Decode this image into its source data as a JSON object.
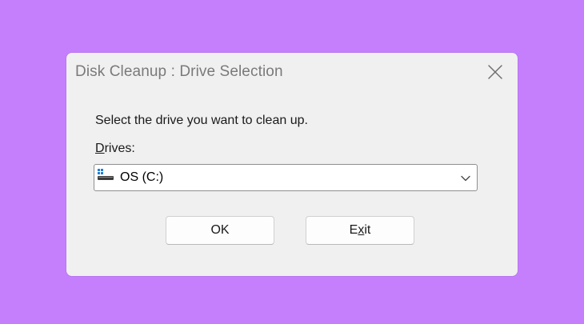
{
  "dialog": {
    "title": "Disk Cleanup : Drive Selection",
    "prompt": "Select the drive you want to clean up.",
    "drives_label": {
      "mnemonic": "D",
      "rest": "rives:"
    },
    "drive_select": {
      "selected_value": "OS (C:)",
      "icon": "drive-icon"
    },
    "buttons": {
      "ok_label": "OK",
      "exit_label": {
        "before": "E",
        "mnemonic": "x",
        "after": "it"
      }
    }
  },
  "colors": {
    "background": "#c57ffd",
    "dialog": "#f0f0f0",
    "title_text": "#7a7a7a",
    "drive_icon_accent": "#1e7fd8"
  }
}
